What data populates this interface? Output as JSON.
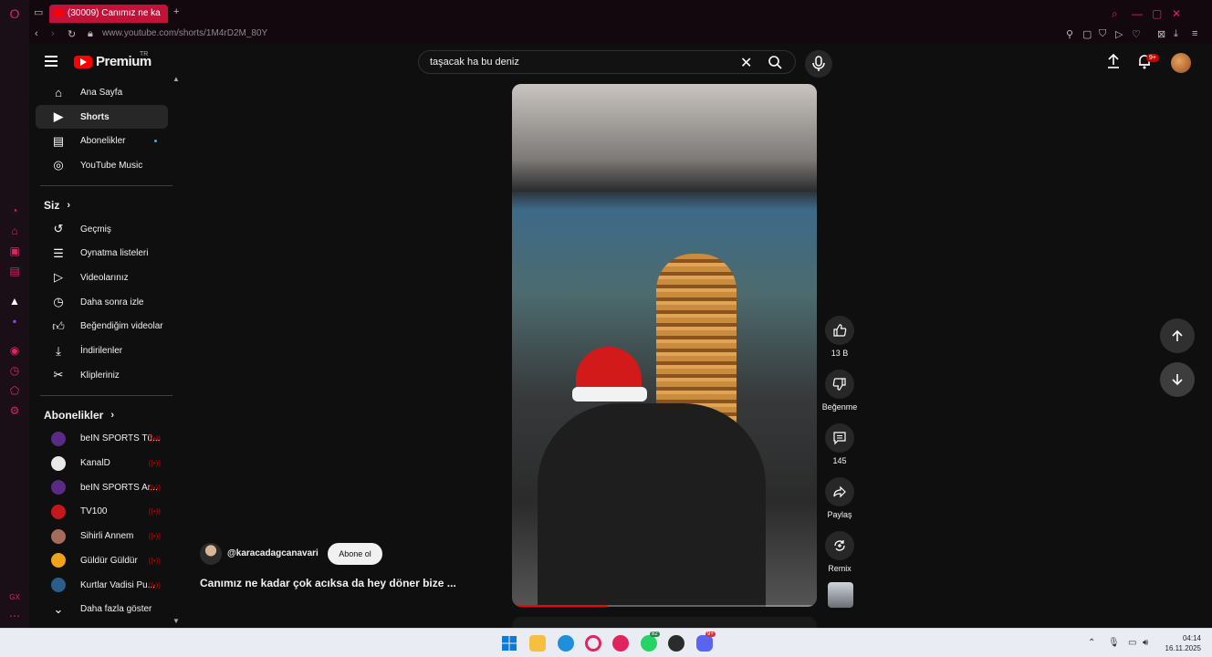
{
  "browser": {
    "tab_title": "(30009) Canımız ne ka",
    "url": "www.youtube.com/shorts/1M4rD2M_80Y"
  },
  "header": {
    "logo_text": "Premium",
    "region": "TR",
    "search_query": "taşacak ha bu deniz",
    "notification_count": "9+"
  },
  "sidebar": {
    "main": [
      {
        "label": "Ana Sayfa",
        "icon": "home-icon"
      },
      {
        "label": "Shorts",
        "icon": "shorts-icon"
      },
      {
        "label": "Abonelikler",
        "icon": "subscriptions-icon"
      },
      {
        "label": "YouTube Music",
        "icon": "music-icon"
      }
    ],
    "you_heading": "Siz",
    "you": [
      {
        "label": "Geçmiş",
        "icon": "history-icon"
      },
      {
        "label": "Oynatma listeleri",
        "icon": "playlist-icon"
      },
      {
        "label": "Videolarınız",
        "icon": "your-videos-icon"
      },
      {
        "label": "Daha sonra izle",
        "icon": "watch-later-icon"
      },
      {
        "label": "Beğendiğim videolar",
        "icon": "like-icon"
      },
      {
        "label": "İndirilenler",
        "icon": "download-icon"
      },
      {
        "label": "Klipleriniz",
        "icon": "scissors-icon"
      }
    ],
    "subs_heading": "Abonelikler",
    "subs": [
      {
        "label": "beIN SPORTS Tü...",
        "color": "#5b2a86"
      },
      {
        "label": "KanalD",
        "color": "#e8e8e8"
      },
      {
        "label": "beIN SPORTS Ar...",
        "color": "#5b2a86"
      },
      {
        "label": "TV100",
        "color": "#c8161d"
      },
      {
        "label": "Sihirli Annem",
        "color": "#a66b5a"
      },
      {
        "label": "Güldür Güldür",
        "color": "#f0a21b"
      },
      {
        "label": "Kurtlar Vadisi Pu...",
        "color": "#2b5c8a"
      }
    ],
    "show_more": "Daha fazla göster"
  },
  "short": {
    "channel": "@karacadagcanavari",
    "subscribe": "Abone ol",
    "title": "Canımız ne kadar çok acıksa da hey döner bize ...",
    "likes": "13 B",
    "dislike_label": "Beğenme",
    "comments": "145",
    "share_label": "Paylaş",
    "remix_label": "Remix",
    "progress": 0.31
  },
  "taskbar": {
    "whatsapp_badge": "82",
    "discord_badge": "9+",
    "time": "04:14",
    "date": "16.11.2025"
  }
}
